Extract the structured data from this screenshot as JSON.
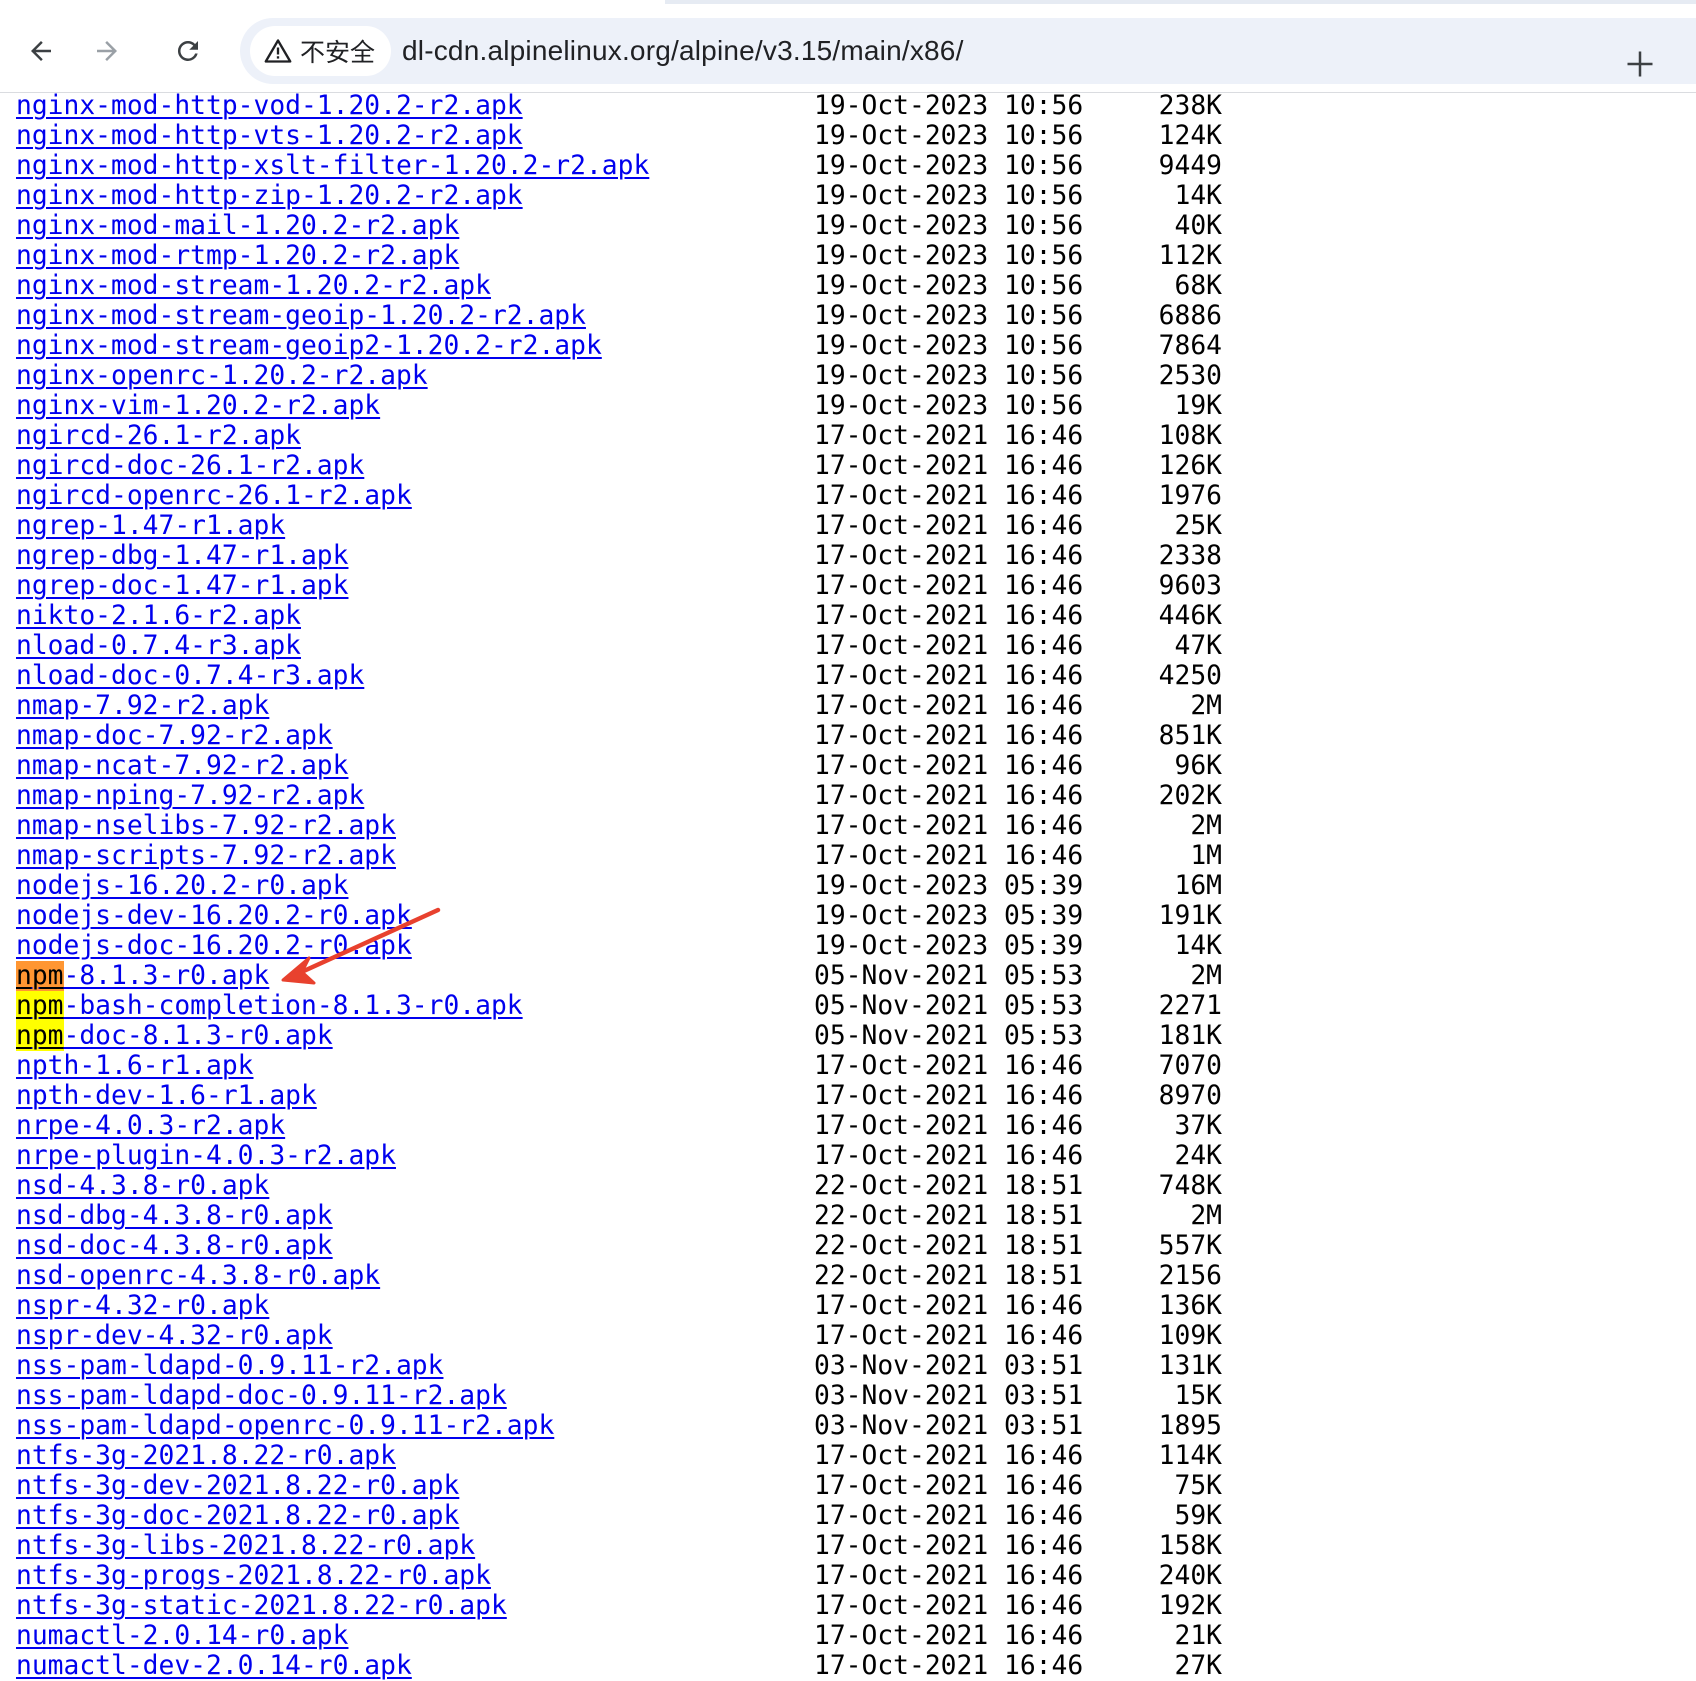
{
  "browser": {
    "security_label": "不安全",
    "url": "dl-cdn.alpinelinux.org/alpine/v3.15/main/x86/",
    "icons": {
      "back": "back-arrow-icon",
      "forward": "forward-arrow-icon",
      "reload": "reload-icon",
      "warning": "warning-triangle-icon",
      "new_tab": "plus-icon"
    }
  },
  "search": {
    "term": "npm",
    "current_match_color": "#ff9632",
    "match_color": "#ffff00"
  },
  "colors": {
    "link": "#0000ee",
    "annotation_arrow": "#e8412e"
  },
  "files": [
    {
      "name": "nginx-mod-http-vod-1.20.2-r2.apk",
      "date": "19-Oct-2023 10:56",
      "size": "238K"
    },
    {
      "name": "nginx-mod-http-vts-1.20.2-r2.apk",
      "date": "19-Oct-2023 10:56",
      "size": "124K"
    },
    {
      "name": "nginx-mod-http-xslt-filter-1.20.2-r2.apk",
      "date": "19-Oct-2023 10:56",
      "size": "9449"
    },
    {
      "name": "nginx-mod-http-zip-1.20.2-r2.apk",
      "date": "19-Oct-2023 10:56",
      "size": "14K"
    },
    {
      "name": "nginx-mod-mail-1.20.2-r2.apk",
      "date": "19-Oct-2023 10:56",
      "size": "40K"
    },
    {
      "name": "nginx-mod-rtmp-1.20.2-r2.apk",
      "date": "19-Oct-2023 10:56",
      "size": "112K"
    },
    {
      "name": "nginx-mod-stream-1.20.2-r2.apk",
      "date": "19-Oct-2023 10:56",
      "size": "68K"
    },
    {
      "name": "nginx-mod-stream-geoip-1.20.2-r2.apk",
      "date": "19-Oct-2023 10:56",
      "size": "6886"
    },
    {
      "name": "nginx-mod-stream-geoip2-1.20.2-r2.apk",
      "date": "19-Oct-2023 10:56",
      "size": "7864"
    },
    {
      "name": "nginx-openrc-1.20.2-r2.apk",
      "date": "19-Oct-2023 10:56",
      "size": "2530"
    },
    {
      "name": "nginx-vim-1.20.2-r2.apk",
      "date": "19-Oct-2023 10:56",
      "size": "19K"
    },
    {
      "name": "ngircd-26.1-r2.apk",
      "date": "17-Oct-2021 16:46",
      "size": "108K"
    },
    {
      "name": "ngircd-doc-26.1-r2.apk",
      "date": "17-Oct-2021 16:46",
      "size": "126K"
    },
    {
      "name": "ngircd-openrc-26.1-r2.apk",
      "date": "17-Oct-2021 16:46",
      "size": "1976"
    },
    {
      "name": "ngrep-1.47-r1.apk",
      "date": "17-Oct-2021 16:46",
      "size": "25K"
    },
    {
      "name": "ngrep-dbg-1.47-r1.apk",
      "date": "17-Oct-2021 16:46",
      "size": "2338"
    },
    {
      "name": "ngrep-doc-1.47-r1.apk",
      "date": "17-Oct-2021 16:46",
      "size": "9603"
    },
    {
      "name": "nikto-2.1.6-r2.apk",
      "date": "17-Oct-2021 16:46",
      "size": "446K"
    },
    {
      "name": "nload-0.7.4-r3.apk",
      "date": "17-Oct-2021 16:46",
      "size": "47K"
    },
    {
      "name": "nload-doc-0.7.4-r3.apk",
      "date": "17-Oct-2021 16:46",
      "size": "4250"
    },
    {
      "name": "nmap-7.92-r2.apk",
      "date": "17-Oct-2021 16:46",
      "size": "2M"
    },
    {
      "name": "nmap-doc-7.92-r2.apk",
      "date": "17-Oct-2021 16:46",
      "size": "851K"
    },
    {
      "name": "nmap-ncat-7.92-r2.apk",
      "date": "17-Oct-2021 16:46",
      "size": "96K"
    },
    {
      "name": "nmap-nping-7.92-r2.apk",
      "date": "17-Oct-2021 16:46",
      "size": "202K"
    },
    {
      "name": "nmap-nselibs-7.92-r2.apk",
      "date": "17-Oct-2021 16:46",
      "size": "2M"
    },
    {
      "name": "nmap-scripts-7.92-r2.apk",
      "date": "17-Oct-2021 16:46",
      "size": "1M"
    },
    {
      "name": "nodejs-16.20.2-r0.apk",
      "date": "19-Oct-2023 05:39",
      "size": "16M"
    },
    {
      "name": "nodejs-dev-16.20.2-r0.apk",
      "date": "19-Oct-2023 05:39",
      "size": "191K"
    },
    {
      "name": "nodejs-doc-16.20.2-r0.apk",
      "date": "19-Oct-2023 05:39",
      "size": "14K"
    },
    {
      "name": "npm-8.1.3-r0.apk",
      "date": "05-Nov-2021 05:53",
      "size": "2M",
      "highlight": "current"
    },
    {
      "name": "npm-bash-completion-8.1.3-r0.apk",
      "date": "05-Nov-2021 05:53",
      "size": "2271",
      "highlight": "match"
    },
    {
      "name": "npm-doc-8.1.3-r0.apk",
      "date": "05-Nov-2021 05:53",
      "size": "181K",
      "highlight": "match"
    },
    {
      "name": "npth-1.6-r1.apk",
      "date": "17-Oct-2021 16:46",
      "size": "7070"
    },
    {
      "name": "npth-dev-1.6-r1.apk",
      "date": "17-Oct-2021 16:46",
      "size": "8970"
    },
    {
      "name": "nrpe-4.0.3-r2.apk",
      "date": "17-Oct-2021 16:46",
      "size": "37K"
    },
    {
      "name": "nrpe-plugin-4.0.3-r2.apk",
      "date": "17-Oct-2021 16:46",
      "size": "24K"
    },
    {
      "name": "nsd-4.3.8-r0.apk",
      "date": "22-Oct-2021 18:51",
      "size": "748K"
    },
    {
      "name": "nsd-dbg-4.3.8-r0.apk",
      "date": "22-Oct-2021 18:51",
      "size": "2M"
    },
    {
      "name": "nsd-doc-4.3.8-r0.apk",
      "date": "22-Oct-2021 18:51",
      "size": "557K"
    },
    {
      "name": "nsd-openrc-4.3.8-r0.apk",
      "date": "22-Oct-2021 18:51",
      "size": "2156"
    },
    {
      "name": "nspr-4.32-r0.apk",
      "date": "17-Oct-2021 16:46",
      "size": "136K"
    },
    {
      "name": "nspr-dev-4.32-r0.apk",
      "date": "17-Oct-2021 16:46",
      "size": "109K"
    },
    {
      "name": "nss-pam-ldapd-0.9.11-r2.apk",
      "date": "03-Nov-2021 03:51",
      "size": "131K"
    },
    {
      "name": "nss-pam-ldapd-doc-0.9.11-r2.apk",
      "date": "03-Nov-2021 03:51",
      "size": "15K"
    },
    {
      "name": "nss-pam-ldapd-openrc-0.9.11-r2.apk",
      "date": "03-Nov-2021 03:51",
      "size": "1895"
    },
    {
      "name": "ntfs-3g-2021.8.22-r0.apk",
      "date": "17-Oct-2021 16:46",
      "size": "114K"
    },
    {
      "name": "ntfs-3g-dev-2021.8.22-r0.apk",
      "date": "17-Oct-2021 16:46",
      "size": "75K"
    },
    {
      "name": "ntfs-3g-doc-2021.8.22-r0.apk",
      "date": "17-Oct-2021 16:46",
      "size": "59K"
    },
    {
      "name": "ntfs-3g-libs-2021.8.22-r0.apk",
      "date": "17-Oct-2021 16:46",
      "size": "158K"
    },
    {
      "name": "ntfs-3g-progs-2021.8.22-r0.apk",
      "date": "17-Oct-2021 16:46",
      "size": "240K"
    },
    {
      "name": "ntfs-3g-static-2021.8.22-r0.apk",
      "date": "17-Oct-2021 16:46",
      "size": "192K"
    },
    {
      "name": "numactl-2.0.14-r0.apk",
      "date": "17-Oct-2021 16:46",
      "size": "21K"
    },
    {
      "name": "numactl-dev-2.0.14-r0.apk",
      "date": "17-Oct-2021 16:46",
      "size": "27K"
    }
  ]
}
